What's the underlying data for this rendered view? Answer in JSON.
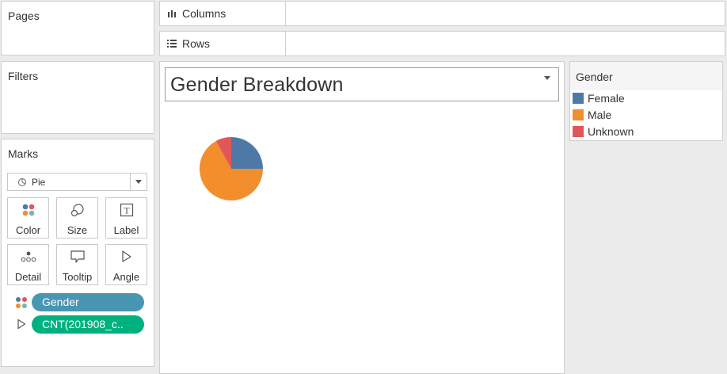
{
  "pages": {
    "label": "Pages"
  },
  "filters": {
    "label": "Filters"
  },
  "columns": {
    "label": "Columns"
  },
  "rows": {
    "label": "Rows"
  },
  "marks": {
    "label": "Marks",
    "mark_type": "Pie",
    "buttons": {
      "color": "Color",
      "size": "Size",
      "label": "Label",
      "detail": "Detail",
      "tooltip": "Tooltip",
      "angle": "Angle"
    },
    "pills": [
      {
        "label": "Gender",
        "encoding": "color",
        "color": "#4996b2"
      },
      {
        "label": "CNT(201908_c..",
        "encoding": "angle",
        "color": "#00b180"
      }
    ]
  },
  "viz": {
    "title": "Gender Breakdown"
  },
  "legend": {
    "title": "Gender",
    "items": [
      {
        "label": "Female",
        "color": "#4e79a7"
      },
      {
        "label": "Male",
        "color": "#f28e2b"
      },
      {
        "label": "Unknown",
        "color": "#e15759"
      }
    ]
  },
  "chart_data": {
    "type": "pie",
    "categories": [
      "Female",
      "Male",
      "Unknown"
    ],
    "values": [
      25,
      67,
      8
    ],
    "colors": [
      "#4e79a7",
      "#f28e2b",
      "#e15759"
    ]
  }
}
